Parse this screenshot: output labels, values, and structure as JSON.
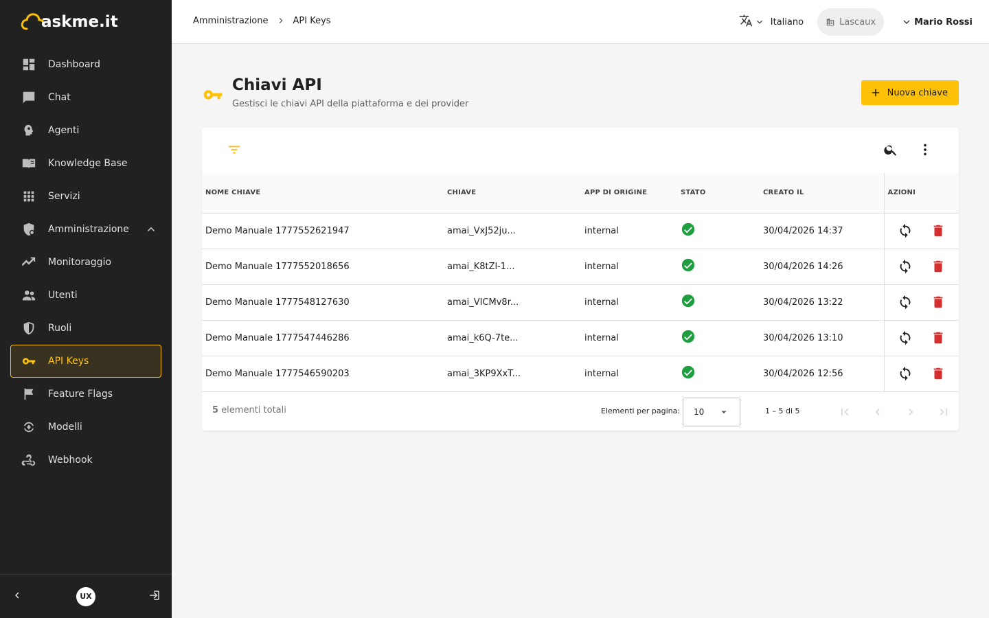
{
  "brand": {
    "name": "askme.it",
    "accent": "#ffc107"
  },
  "sidebar": {
    "items": [
      {
        "label": "Dashboard",
        "icon": "dashboard-icon"
      },
      {
        "label": "Chat",
        "icon": "chat-icon"
      },
      {
        "label": "Agenti",
        "icon": "agent-icon"
      },
      {
        "label": "Knowledge Base",
        "icon": "book-icon"
      },
      {
        "label": "Servizi",
        "icon": "grid-icon"
      },
      {
        "label": "Amministrazione",
        "icon": "admin-shield-icon",
        "expanded": true
      },
      {
        "label": "Monitoraggio",
        "icon": "trend-icon"
      },
      {
        "label": "Utenti",
        "icon": "users-icon"
      },
      {
        "label": "Ruoli",
        "icon": "shield-icon"
      },
      {
        "label": "API Keys",
        "icon": "key-icon",
        "active": true
      },
      {
        "label": "Feature Flags",
        "icon": "flag-icon"
      },
      {
        "label": "Modelli",
        "icon": "model-icon"
      },
      {
        "label": "Webhook",
        "icon": "webhook-icon"
      }
    ],
    "footer": {
      "badge": "UX"
    }
  },
  "header": {
    "breadcrumb": [
      "Amministrazione",
      "API Keys"
    ],
    "language": "Italiano",
    "tenant": "Lascaux",
    "user": "Mario Rossi"
  },
  "page": {
    "title": "Chiavi API",
    "subtitle": "Gestisci le chiavi API della piattaforma e dei provider",
    "new_button": "Nuova chiave"
  },
  "table": {
    "columns": [
      "NOME CHIAVE",
      "CHIAVE",
      "APP DI ORIGINE",
      "STATO",
      "CREATO IL",
      "AZIONI"
    ],
    "rows": [
      {
        "name": "Demo Manuale 1777552621947",
        "key": "amai_VxJ52ju...",
        "app": "internal",
        "status": "active",
        "created": "30/04/2026 14:37"
      },
      {
        "name": "Demo Manuale 1777552018656",
        "key": "amai_K8tZl-1...",
        "app": "internal",
        "status": "active",
        "created": "30/04/2026 14:26"
      },
      {
        "name": "Demo Manuale 1777548127630",
        "key": "amai_VICMv8r...",
        "app": "internal",
        "status": "active",
        "created": "30/04/2026 13:22"
      },
      {
        "name": "Demo Manuale 1777547446286",
        "key": "amai_k6Q-7te...",
        "app": "internal",
        "status": "active",
        "created": "30/04/2026 13:10"
      },
      {
        "name": "Demo Manuale 1777546590203",
        "key": "amai_3KP9XxT...",
        "app": "internal",
        "status": "active",
        "created": "30/04/2026 12:56"
      }
    ]
  },
  "footer": {
    "total_count": "5",
    "total_label": "elementi totali",
    "per_page_label": "Elementi per pagina:",
    "per_page_value": "10",
    "range": "1 – 5 di 5"
  },
  "colors": {
    "status_ok": "#1e9e3e",
    "delete": "#d32f2f",
    "sidebar_bg": "#212121"
  }
}
